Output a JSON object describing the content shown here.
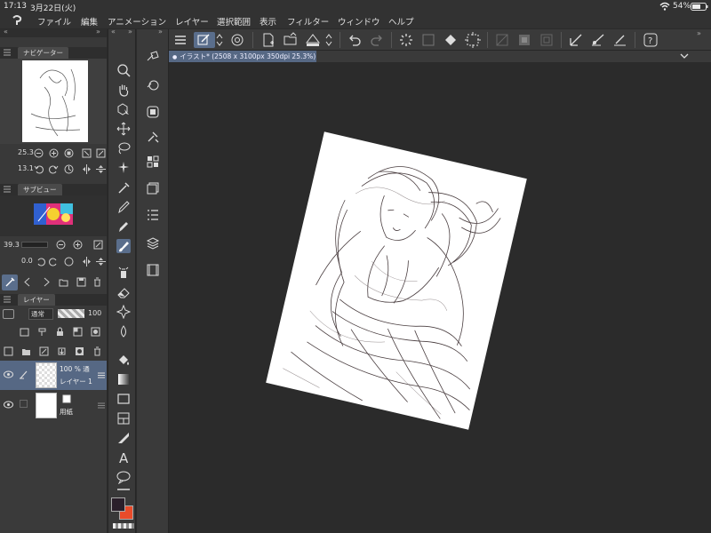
{
  "status": {
    "time": "17:13",
    "date": "3月22日(火)",
    "battery": "54%"
  },
  "menu": [
    "ファイル",
    "編集",
    "アニメーション",
    "レイヤー",
    "選択範囲",
    "表示",
    "フィルター",
    "ウィンドウ",
    "ヘルプ"
  ],
  "document_tab": {
    "label": "イラスト* (2508 x 3100px 350dpi 25.3%)"
  },
  "navigator": {
    "title": "ナビゲーター",
    "zoom": "25.3",
    "rotation": "13.1"
  },
  "subview": {
    "title": "サブビュー",
    "zoom": "39.3",
    "rotation": "0.0"
  },
  "layers_panel": {
    "title": "レイヤー",
    "blend_mode": "通常",
    "opacity": "100",
    "layers": [
      {
        "opacity_mode": "100 % 通",
        "name": "レイヤー 1"
      },
      {
        "opacity_mode": "",
        "name": "用紙"
      }
    ]
  },
  "icons": {
    "tools": [
      "zoom-icon",
      "hand-icon",
      "object-select-icon",
      "move-icon",
      "lasso-select-icon",
      "auto-select-icon",
      "eyedropper-icon",
      "pen-icon",
      "pencil-icon",
      "brush-icon",
      "airbrush-icon",
      "eraser-icon",
      "blend-icon",
      "water-drop-icon",
      "fill-icon",
      "gradient-icon",
      "rectangle-icon",
      "frame-icon",
      "ruler-icon",
      "text-icon",
      "balloon-icon",
      "correction-icon"
    ]
  },
  "colors": {
    "accent": "#566884",
    "main_color": "#2a1f2a",
    "sub_color": "#e94b2a",
    "background": "#2b2b2b"
  }
}
